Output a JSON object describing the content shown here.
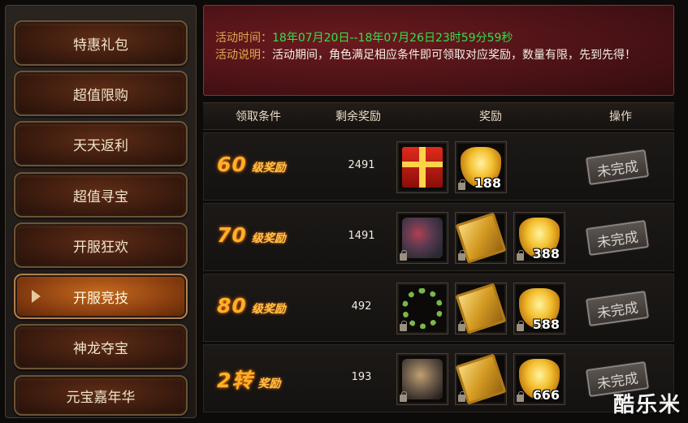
{
  "sidebar": {
    "items": [
      {
        "label": "特惠礼包",
        "active": false
      },
      {
        "label": "超值限购",
        "active": false
      },
      {
        "label": "天天返利",
        "active": false
      },
      {
        "label": "超值寻宝",
        "active": false
      },
      {
        "label": "开服狂欢",
        "active": false
      },
      {
        "label": "开服竞技",
        "active": true
      },
      {
        "label": "神龙夺宝",
        "active": false
      },
      {
        "label": "元宝嘉年华",
        "active": false
      }
    ]
  },
  "info": {
    "time_label": "活动时间：",
    "time_value": "18年07月20日--18年07月26日23时59分59秒",
    "desc_label": "活动说明：",
    "desc_value": "活动期间，角色满足相应条件即可领取对应奖励，数量有限，先到先得！"
  },
  "table": {
    "headers": {
      "condition": "领取条件",
      "remaining": "剩余奖励",
      "reward": "奖励",
      "action": "操作"
    },
    "rows": [
      {
        "level_num": "60",
        "level_suffix": "级奖励",
        "remaining": "2491",
        "rewards": [
          {
            "icon": "gift-box-icon",
            "count": ""
          },
          {
            "icon": "gold-ingot-icon",
            "count": "188"
          }
        ],
        "action": "未完成"
      },
      {
        "level_num": "70",
        "level_suffix": "级奖励",
        "remaining": "1491",
        "rewards": [
          {
            "icon": "armor-icon",
            "count": ""
          },
          {
            "icon": "gold-bar-icon",
            "count": ""
          },
          {
            "icon": "gold-ingot-icon",
            "count": "388"
          }
        ],
        "action": "未完成"
      },
      {
        "level_num": "80",
        "level_suffix": "级奖励",
        "remaining": "492",
        "rewards": [
          {
            "icon": "bead-necklace-icon",
            "count": ""
          },
          {
            "icon": "gold-bar-icon",
            "count": ""
          },
          {
            "icon": "gold-ingot-icon",
            "count": "588"
          }
        ],
        "action": "未完成"
      },
      {
        "level_num": "2转",
        "level_suffix": "奖励",
        "remaining": "193",
        "rewards": [
          {
            "icon": "armor-icon",
            "count": ""
          },
          {
            "icon": "gold-bar-icon",
            "count": ""
          },
          {
            "icon": "gold-ingot-icon",
            "count": "666"
          }
        ],
        "action": "未完成"
      }
    ]
  },
  "watermark": "酷乐米",
  "colors": {
    "time_green": "#33e04c",
    "label_gold": "#e2a850",
    "level_orange": "#ffb02a"
  }
}
